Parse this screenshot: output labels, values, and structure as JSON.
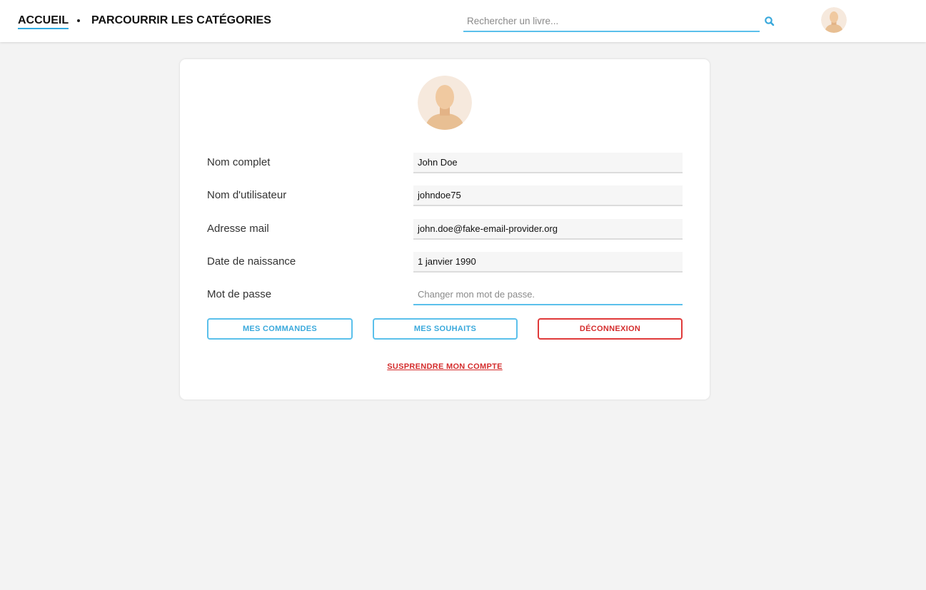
{
  "header": {
    "nav": {
      "home_label": "ACCUEIL",
      "categories_label": "PARCOURRIR LES CATÉGORIES"
    },
    "search": {
      "placeholder": "Rechercher un livre...",
      "icon": "search-icon"
    },
    "avatar_icon": "user-avatar-icon"
  },
  "profile": {
    "avatar_icon": "user-avatar-icon",
    "fields": [
      {
        "label": "Nom complet",
        "value": "John Doe"
      },
      {
        "label": "Nom d'utilisateur",
        "value": "johndoe75"
      },
      {
        "label": "Adresse mail",
        "value": "john.doe@fake-email-provider.org"
      },
      {
        "label": "Date de naissance",
        "value": "1 janvier 1990"
      },
      {
        "label": "Mot de passe",
        "value": "",
        "placeholder": "Changer mon mot de passe."
      }
    ],
    "buttons": {
      "orders": "MES COMMANDES",
      "wishes": "MES SOUHAITS",
      "logout": "DÉCONNEXION"
    },
    "suspend_label": "SUSPRENDRE MON COMPTE"
  },
  "colors": {
    "accent": "#5bc0eb",
    "danger": "#e03a3a",
    "page_background": "#f3f3f3"
  }
}
